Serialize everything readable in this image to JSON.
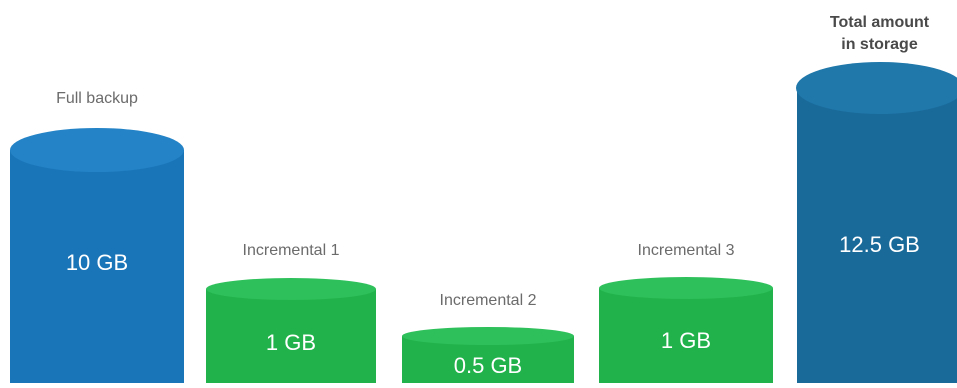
{
  "cylinders": [
    {
      "id": "full",
      "label": "Full backup",
      "value": "10 GB",
      "color": "#1a75b8"
    },
    {
      "id": "inc1",
      "label": "Incremental 1",
      "value": "1 GB",
      "color": "#22b24c"
    },
    {
      "id": "inc2",
      "label": "Incremental 2",
      "value": "0.5 GB",
      "color": "#22b24c"
    },
    {
      "id": "inc3",
      "label": "Incremental 3",
      "value": "1 GB",
      "color": "#22b24c"
    },
    {
      "id": "total",
      "label_line1": "Total amount",
      "label_line2": "in storage",
      "value": "12.5 GB",
      "color": "#1a6a99"
    }
  ]
}
